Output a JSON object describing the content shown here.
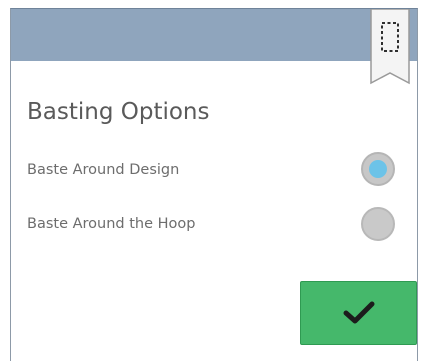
{
  "dialog": {
    "title": "Basting Options",
    "header_color": "#8fa5bd",
    "bookmark_icon": "bookmark-frame-icon"
  },
  "options": [
    {
      "label": "Baste Around Design",
      "selected": true
    },
    {
      "label": "Baste Around the Hoop",
      "selected": false
    }
  ],
  "colors": {
    "selected_radio": "#6cc3e8",
    "confirm_button": "#45b86b"
  },
  "confirm": {
    "icon": "checkmark-icon"
  }
}
